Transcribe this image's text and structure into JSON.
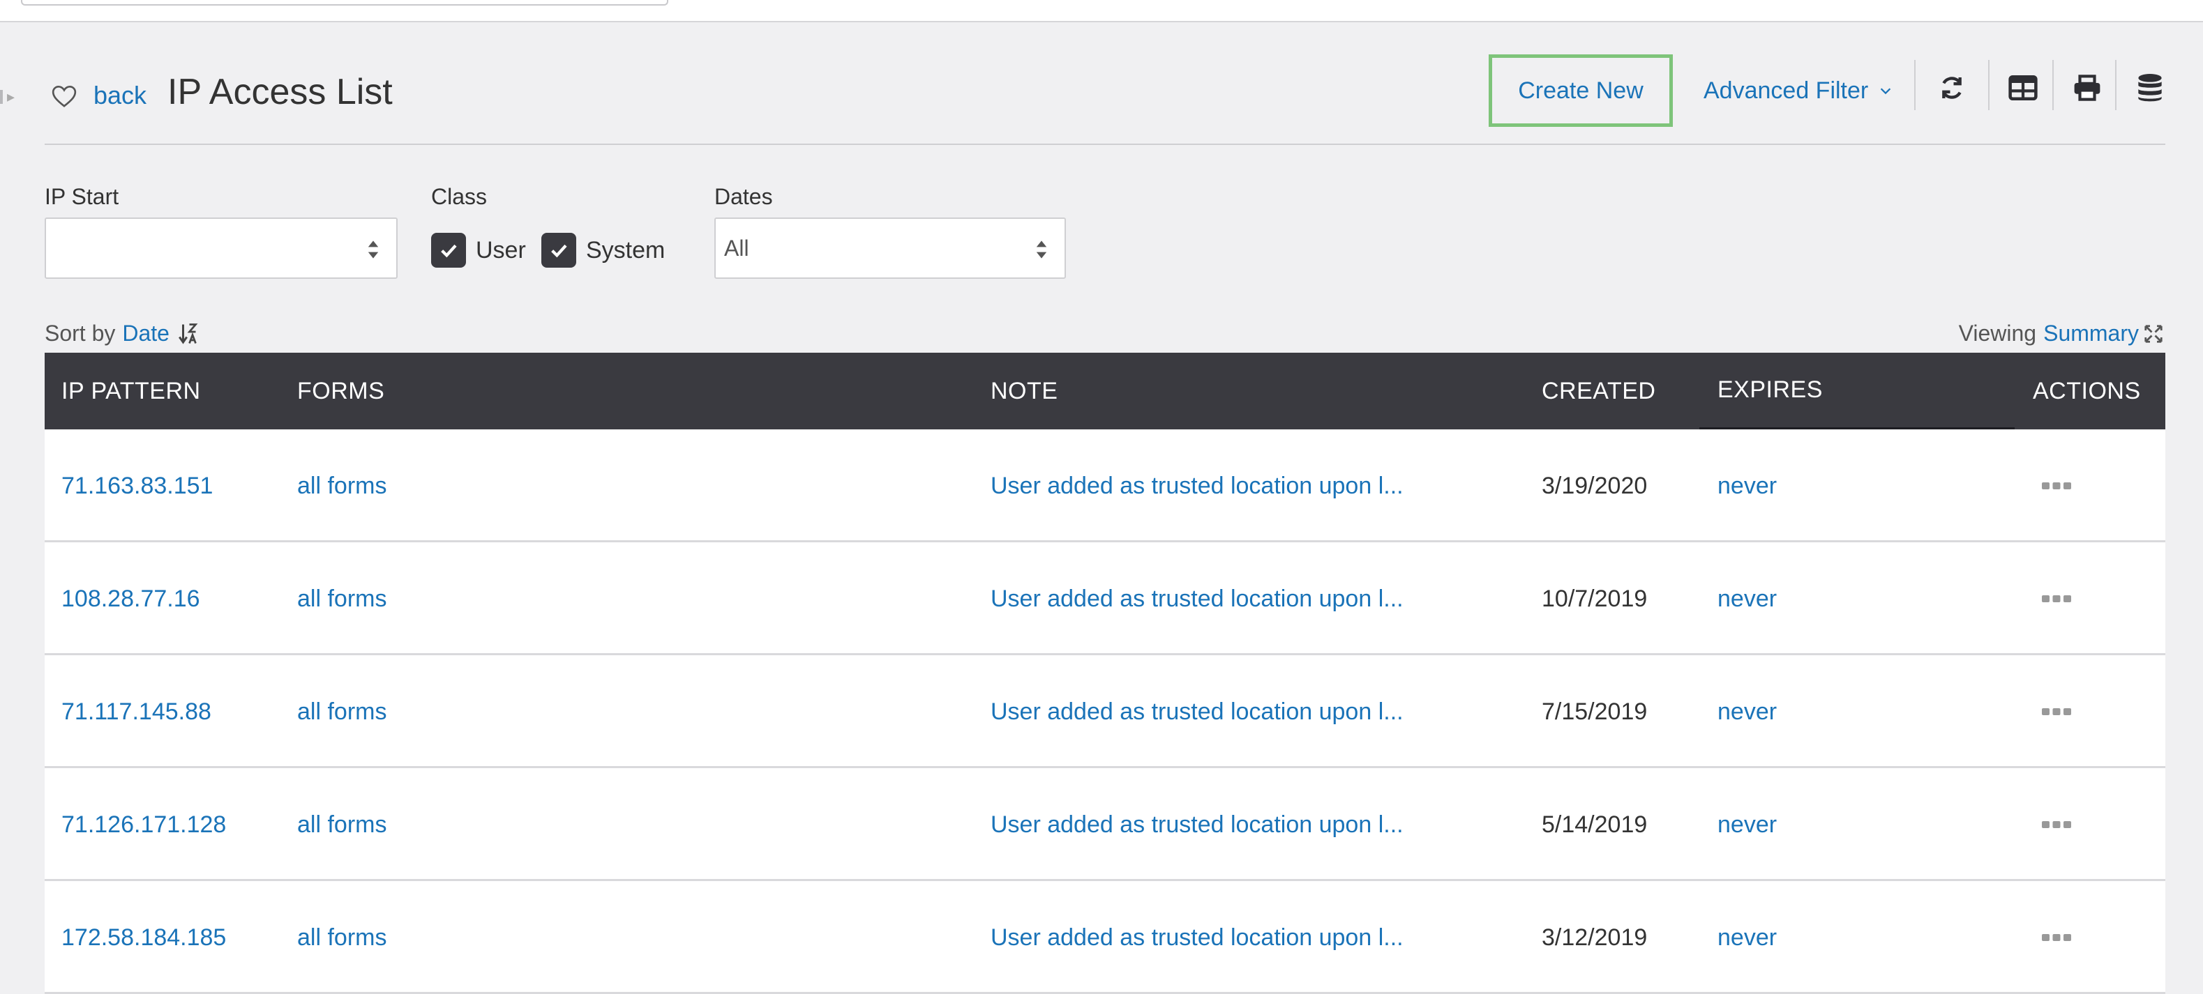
{
  "header": {
    "back_label": "back",
    "title": "IP Access List",
    "create_label": "Create New",
    "advanced_filter_label": "Advanced Filter"
  },
  "filters": {
    "ip_start_label": "IP Start",
    "ip_start_value": "",
    "class_label": "Class",
    "class_user_label": "User",
    "class_system_label": "System",
    "dates_label": "Dates",
    "dates_value": "All"
  },
  "sort": {
    "prefix": "Sort by",
    "field": "Date"
  },
  "viewing": {
    "prefix": "Viewing",
    "mode": "Summary"
  },
  "table": {
    "headers": {
      "ip_pattern": "IP PATTERN",
      "forms": "FORMS",
      "note": "NOTE",
      "created": "CREATED",
      "expires": "EXPIRES",
      "actions": "ACTIONS"
    },
    "rows": [
      {
        "ip": "71.163.83.151",
        "forms": "all forms",
        "note": "User added as trusted location upon l...",
        "created": "3/19/2020",
        "expires": "never"
      },
      {
        "ip": "108.28.77.16",
        "forms": "all forms",
        "note": "User added as trusted location upon l...",
        "created": "10/7/2019",
        "expires": "never"
      },
      {
        "ip": "71.117.145.88",
        "forms": "all forms",
        "note": "User added as trusted location upon l...",
        "created": "7/15/2019",
        "expires": "never"
      },
      {
        "ip": "71.126.171.128",
        "forms": "all forms",
        "note": "User added as trusted location upon l...",
        "created": "5/14/2019",
        "expires": "never"
      },
      {
        "ip": "172.58.184.185",
        "forms": "all forms",
        "note": "User added as trusted location upon l...",
        "created": "3/12/2019",
        "expires": "never"
      }
    ]
  },
  "icons": {
    "favorite": "heart-outline-icon",
    "refresh": "refresh-icon",
    "columns": "table-columns-icon",
    "print": "print-icon",
    "database": "database-icon",
    "sort": "sort-desc-icon",
    "expand": "expand-icon",
    "actions": "ellipsis-icon"
  },
  "colors": {
    "link": "#1a73b8",
    "table_header": "#3a3a40",
    "create_highlight": "#7ec47a",
    "background": "#f0f0f2"
  }
}
